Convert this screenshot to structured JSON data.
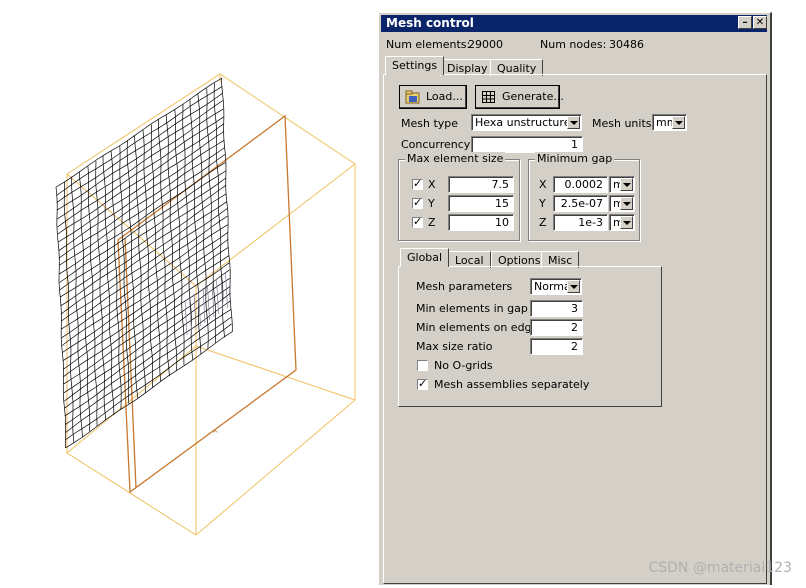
{
  "dialog": {
    "title": "Mesh control",
    "num_elements_label": "Num elements:",
    "num_elements_value": "29000",
    "num_nodes_label": "Num nodes:",
    "num_nodes_value": "30486",
    "tabs": [
      "Settings",
      "Display",
      "Quality"
    ],
    "active_tab": "Settings"
  },
  "settings": {
    "load_label": "Load...",
    "generate_label": "Generate...",
    "mesh_type_label": "Mesh type",
    "mesh_type_value": "Hexa unstructured",
    "mesh_units_label": "Mesh units",
    "mesh_units_value": "mm",
    "concurrency_label": "Concurrency",
    "concurrency_value": "1",
    "max_element_size": {
      "title": "Max element size",
      "rows": [
        {
          "axis": "X",
          "checked": true,
          "value": "7.5"
        },
        {
          "axis": "Y",
          "checked": true,
          "value": "15"
        },
        {
          "axis": "Z",
          "checked": true,
          "value": "10"
        }
      ]
    },
    "minimum_gap": {
      "title": "Minimum gap",
      "rows": [
        {
          "axis": "X",
          "value": "0.0002",
          "unit": "m"
        },
        {
          "axis": "Y",
          "value": "2.5e-07",
          "unit": "m"
        },
        {
          "axis": "Z",
          "value": "1e-3",
          "unit": "m"
        }
      ]
    }
  },
  "sub_tabs": [
    "Global",
    "Local",
    "Options",
    "Misc"
  ],
  "active_sub_tab": "Global",
  "global": {
    "mesh_parameters_label": "Mesh parameters",
    "mesh_parameters_value": "Normal",
    "min_elements_in_gap_label": "Min elements in gap",
    "min_elements_in_gap_value": "3",
    "min_elements_on_edge_label": "Min elements on edge",
    "min_elements_on_edge_value": "2",
    "max_size_ratio_label": "Max size ratio",
    "max_size_ratio_value": "2",
    "no_ogrids_label": "No O-grids",
    "no_ogrids_checked": false,
    "mesh_assemblies_label": "Mesh assemblies separately",
    "mesh_assemblies_checked": true
  },
  "watermark": "CSDN @material123",
  "colors": {
    "titlebar": "#0a246a",
    "dialog_bg": "#d4d0c8",
    "box_outline": "#f0c060",
    "plate_outline": "#c87830",
    "mesh_line": "#000000"
  }
}
